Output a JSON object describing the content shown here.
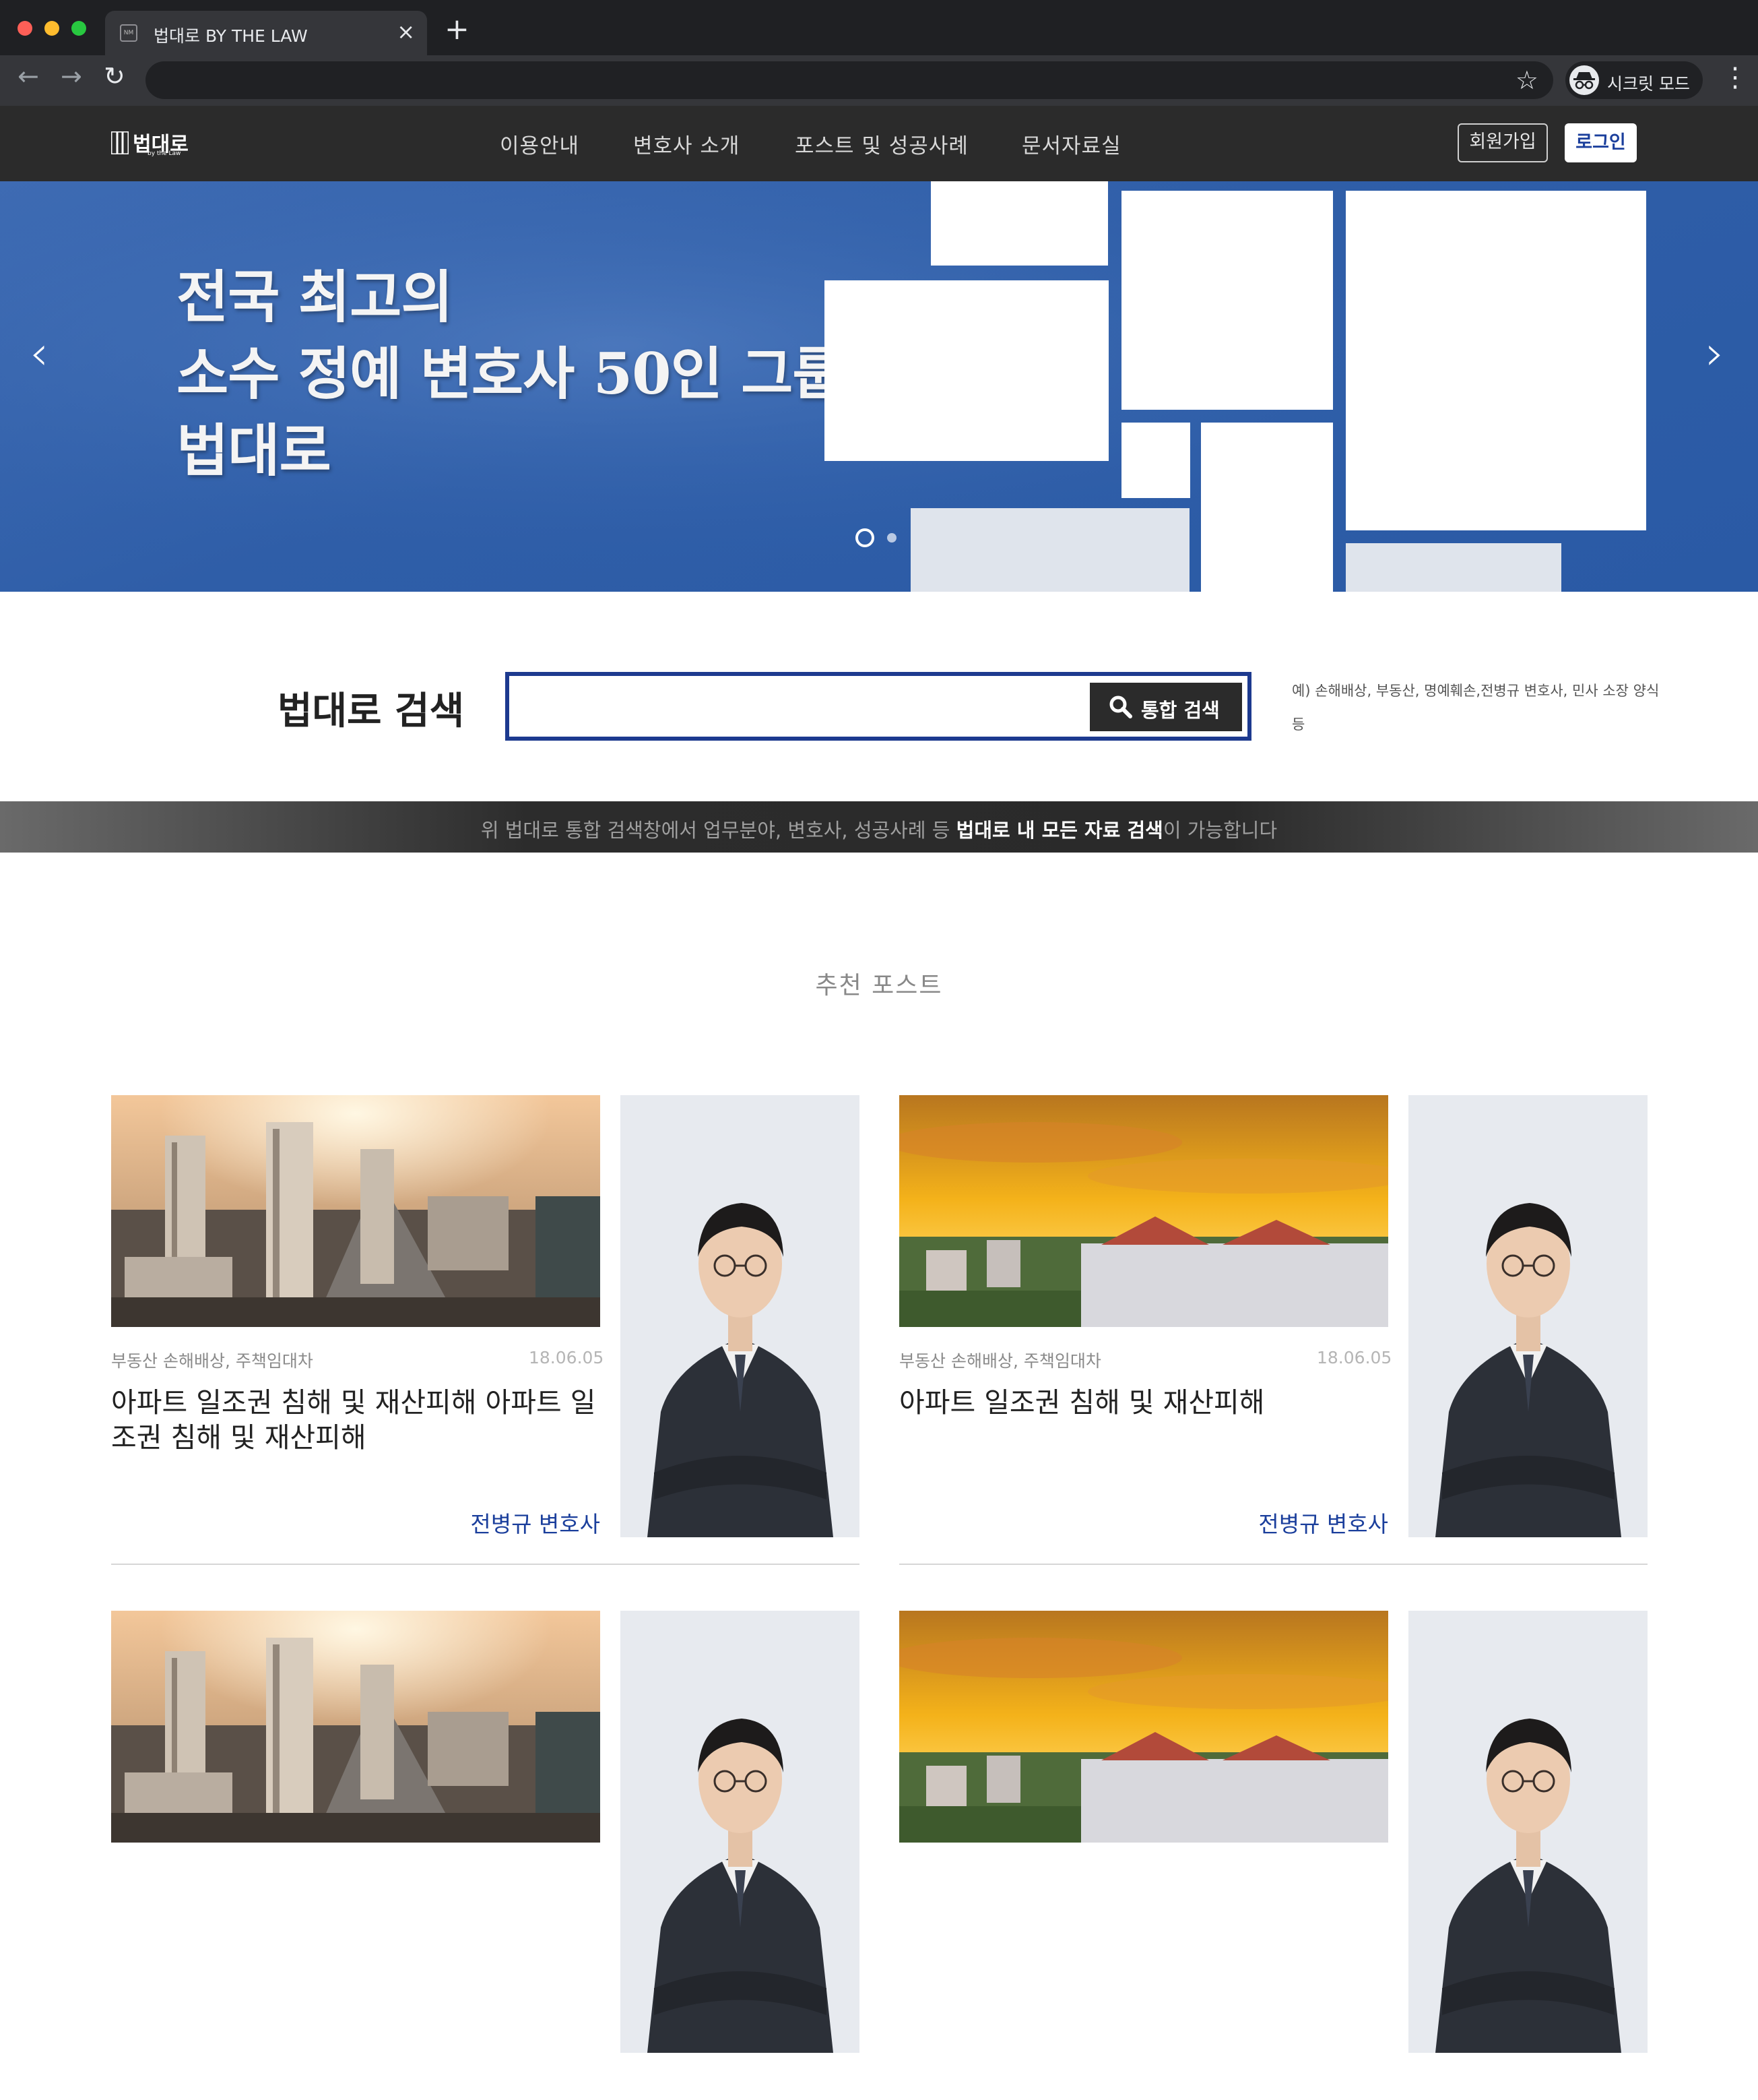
{
  "browser": {
    "tab_title": "법대로 BY THE LAW",
    "favicon_text": "NM",
    "incognito_label": "시크릿 모드"
  },
  "header": {
    "logo_text": "법대로",
    "logo_sub": "by the Law",
    "nav": [
      "이용안내",
      "변호사 소개",
      "포스트 및 성공사례",
      "문서자료실"
    ],
    "signup_label": "회원가입",
    "login_label": "로그인"
  },
  "hero": {
    "lines": [
      "전국 최고의",
      "소수 정예 변호사 50인 그룹",
      "법대로"
    ],
    "slides_count": 2,
    "active_slide": 1,
    "colors": {
      "bg": "#2f5ea8",
      "panel": "#ffffff"
    }
  },
  "search": {
    "title": "법대로 검색",
    "input_value": "",
    "button_label": "통합 검색",
    "hint": "예) 손해배상, 부동산, 명예훼손,전병규 변호사, 민사 소장 양식 등"
  },
  "notice": {
    "before": "위 법대로 통합 검색창에서 업무분야, 변호사, 성공사례 등 ",
    "bold": "법대로 내 모든 자료 검색",
    "after": "이 가능합니다"
  },
  "section": {
    "title": "추천 포스트"
  },
  "cards": [
    {
      "category": "부동산 손해배상, 주책임대차",
      "date": "18.06.05",
      "title": "아파트 일조권 침해 및 재산피해 아파트 일조권 침해 및 재산피해",
      "author": "전병규 변호사",
      "thumb": "city"
    },
    {
      "category": "부동산 손해배상, 주책임대차",
      "date": "18.06.05",
      "title": "아파트 일조권 침해 및 재산피해",
      "author": "전병규 변호사",
      "thumb": "sunset"
    },
    {
      "category": "",
      "date": "",
      "title": "",
      "author": "",
      "thumb": "city"
    },
    {
      "category": "",
      "date": "",
      "title": "",
      "author": "",
      "thumb": "sunset"
    }
  ],
  "colors": {
    "brand_blue": "#1b3f9c",
    "search_border": "#1d3a8f",
    "header_bg": "#2b2b2b"
  }
}
